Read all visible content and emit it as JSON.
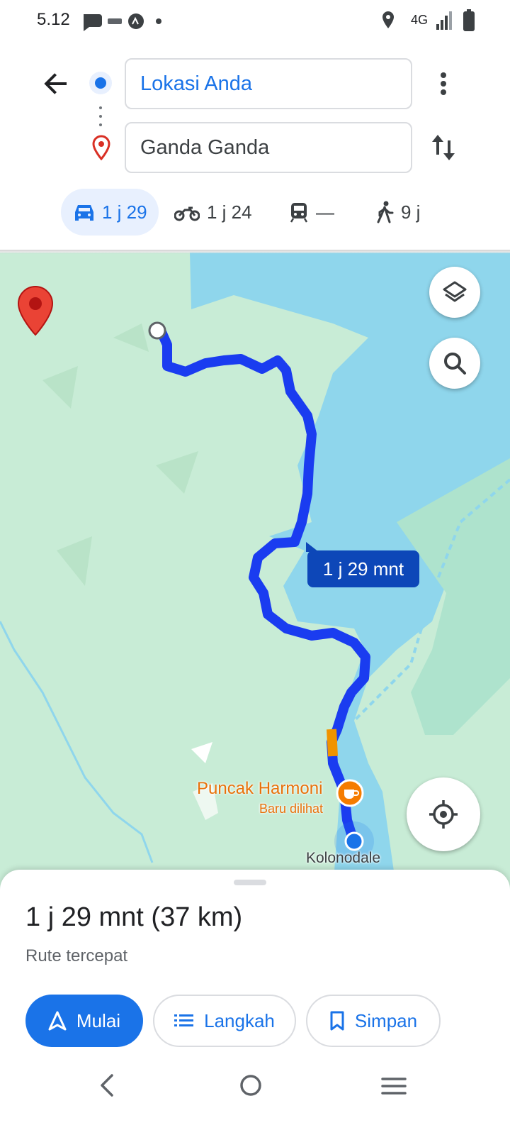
{
  "status_bar": {
    "time": "5.12",
    "network": "4G"
  },
  "directions": {
    "origin": "Lokasi Anda",
    "destination": "Ganda Ganda"
  },
  "modes": [
    {
      "id": "car",
      "label": "1 j 29",
      "selected": true
    },
    {
      "id": "motorcycle",
      "label": "1 j 24",
      "selected": false
    },
    {
      "id": "transit",
      "label": "—",
      "selected": false
    },
    {
      "id": "walk",
      "label": "9 j",
      "selected": false
    }
  ],
  "map": {
    "route_label": "1 j 29 mnt",
    "poi_name": "Puncak Harmoni",
    "poi_sub": "Baru dilihat",
    "town": "Kolonodale"
  },
  "sheet": {
    "summary": "1 j 29 mnt (37 km)",
    "note": "Rute tercepat",
    "start_label": "Mulai",
    "steps_label": "Langkah",
    "save_label": "Simpan"
  },
  "colors": {
    "accent": "#1a73e8",
    "route": "#1a3cf0",
    "water": "#8fd6ec",
    "land": "#c8ecd6",
    "poi": "#e8710a",
    "pin": "#d93025"
  }
}
